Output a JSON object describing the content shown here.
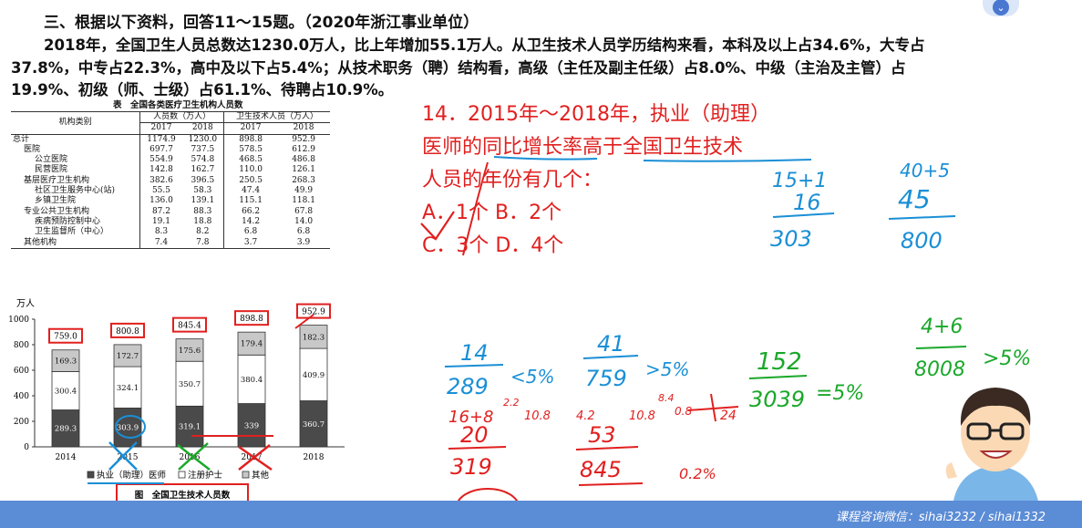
{
  "passage": {
    "heading": "三、根据以下资料，回答11～15题。（2020年浙江事业单位）",
    "line1": "2018年，全国卫生人员总数达1230.0万人，比上年增加55.1万人。从卫生技术人员学历结构来看，本科及以上占34.6%，大专占",
    "line2": "37.8%，中专占22.3%，高中及以下占5.4%；从技术职务（聘）结构看，高级（主任及副主任级）占8.0%、中级（主治及主管）占",
    "line3": "19.9%、初级（师、士级）占61.1%、待聘占10.9%。"
  },
  "table": {
    "title": "表　全国各类医疗卫生机构人员数",
    "col_category": "机构类别",
    "group1": "人员数（万人）",
    "group2": "卫生技术人员（万人）",
    "years": [
      "2017",
      "2018",
      "2017",
      "2018"
    ],
    "rows": [
      {
        "name": "总计",
        "v": [
          "1174.9",
          "1230.0",
          "898.8",
          "952.9"
        ],
        "indent": 0
      },
      {
        "name": "医院",
        "v": [
          "697.7",
          "737.5",
          "578.5",
          "612.9"
        ],
        "indent": 1
      },
      {
        "name": "公立医院",
        "v": [
          "554.9",
          "574.8",
          "468.5",
          "486.8"
        ],
        "indent": 2
      },
      {
        "name": "民营医院",
        "v": [
          "142.8",
          "162.7",
          "110.0",
          "126.1"
        ],
        "indent": 2
      },
      {
        "name": "基层医疗卫生机构",
        "v": [
          "382.6",
          "396.5",
          "250.5",
          "268.3"
        ],
        "indent": 1
      },
      {
        "name": "社区卫生服务中心(站)",
        "v": [
          "55.5",
          "58.3",
          "47.4",
          "49.9"
        ],
        "indent": 2
      },
      {
        "name": "乡镇卫生院",
        "v": [
          "136.0",
          "139.1",
          "115.1",
          "118.1"
        ],
        "indent": 2
      },
      {
        "name": "专业公共卫生机构",
        "v": [
          "87.2",
          "88.3",
          "66.2",
          "67.8"
        ],
        "indent": 1
      },
      {
        "name": "疾病预防控制中心",
        "v": [
          "19.1",
          "18.8",
          "14.2",
          "14.0"
        ],
        "indent": 2
      },
      {
        "name": "卫生监督所（中心）",
        "v": [
          "8.3",
          "8.2",
          "6.8",
          "6.8"
        ],
        "indent": 2
      },
      {
        "name": "其他机构",
        "v": [
          "7.4",
          "7.8",
          "3.7",
          "3.9"
        ],
        "indent": 1
      }
    ]
  },
  "chart_data": {
    "type": "bar",
    "stacked": true,
    "unit_label": "万人",
    "categories": [
      "2014",
      "2015",
      "2016",
      "2017",
      "2018"
    ],
    "series": [
      {
        "name": "执业（助理）医师",
        "values": [
          289.3,
          303.9,
          319.1,
          339.0,
          360.7
        ],
        "color": "#4a4a4a"
      },
      {
        "name": "注册护士",
        "values": [
          300.4,
          324.1,
          350.7,
          380.4,
          409.9
        ],
        "color": "#ffffff"
      },
      {
        "name": "其他",
        "values": [
          169.3,
          172.7,
          175.6,
          179.4,
          182.3
        ],
        "color": "#c8c8c8"
      }
    ],
    "totals": [
      "759.0",
      "800.8",
      "845.4",
      "898.8",
      "952.9"
    ],
    "ylim": [
      0,
      1000
    ],
    "yticks": [
      0,
      200,
      400,
      600,
      800,
      1000
    ],
    "caption": "图　全国卫生技术人员数",
    "grid": false,
    "legend_position": "bottom"
  },
  "question": {
    "line1": "14．2015年～2018年，执业（助理）",
    "line2": "医师的同比增长率高于全国卫生技术",
    "line3": "人员的年份有几个：",
    "line4": "A．1个 B．2个",
    "line5": "C．3个 D．4个"
  },
  "annotations": {
    "red": {
      "a1": "14",
      "a2": "289",
      "a3": "<5%",
      "a4": "41",
      "a5": "759",
      "a6": ">5%",
      "a7": "152",
      "a8": "3039",
      "a9": "=5%",
      "b1": "16+8",
      "b2": "20",
      "b3": "319",
      "b4": "53",
      "b5": "845",
      "b6": "0.2%",
      "b7": "2.2",
      "b8": "10.8",
      "b9": "8.4",
      "b10": "4.2",
      "b11": "0.8",
      "b12": "24"
    },
    "green": {
      "g1": "152",
      "g2": "3039",
      "g3": "=5%",
      "g4": "4+6",
      "g5": "8008",
      "g6": ">5%"
    },
    "blue": {
      "c1": "14",
      "c2": "289",
      "c3": "<5%",
      "c4": "41",
      "c5": "759",
      "c6": ">5%",
      "c7": "15+1",
      "c8": "16",
      "c9": "303",
      "c10": "40+5",
      "c11": "45",
      "c12": "800"
    }
  },
  "footer": {
    "contact": "课程咨询微信：sihai3232 / sihai1332"
  },
  "colors": {
    "question_red": "#e0201f",
    "annotation_blue": "#1a8fd6",
    "annotation_green": "#1aa82a",
    "footer_bar": "#5b8cd6"
  }
}
